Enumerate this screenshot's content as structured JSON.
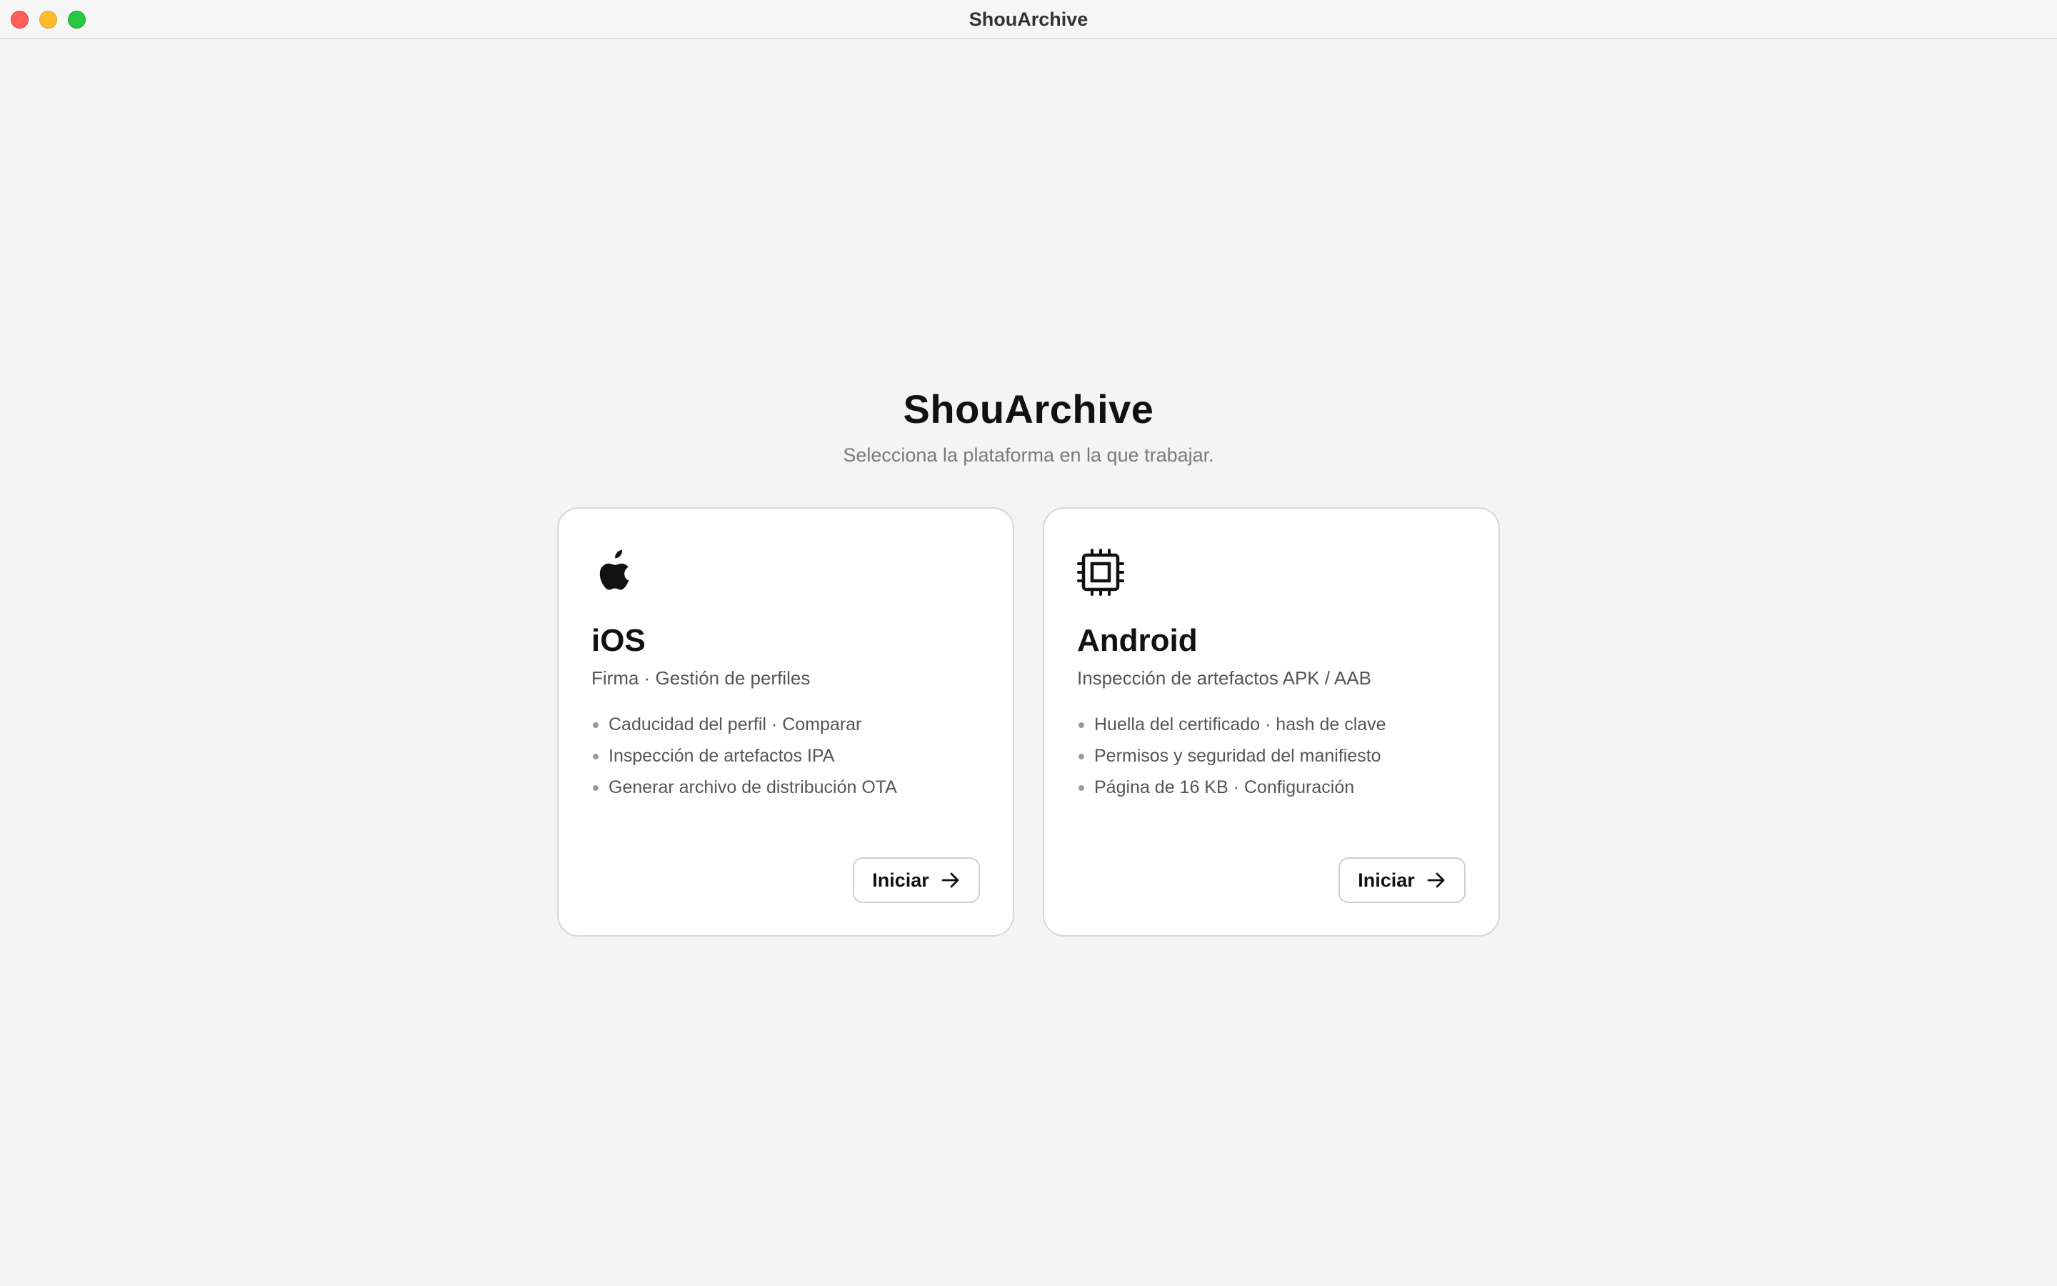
{
  "window": {
    "title": "ShouArchive"
  },
  "header": {
    "title": "ShouArchive",
    "subtitle": "Selecciona la plataforma en la que trabajar."
  },
  "platforms": [
    {
      "icon": "apple-logo-icon",
      "title": "iOS",
      "subtitle": "Firma · Gestión de perfiles",
      "features": [
        "Caducidad del perfil · Comparar",
        "Inspección de artefactos IPA",
        "Generar archivo de distribución OTA"
      ],
      "button_label": "Iniciar"
    },
    {
      "icon": "chip-icon",
      "title": "Android",
      "subtitle": "Inspección de artefactos APK / AAB",
      "features": [
        "Huella del certificado · hash de clave",
        "Permisos y seguridad del manifiesto",
        "Página de 16 KB · Configuración"
      ],
      "button_label": "Iniciar"
    }
  ],
  "colors": {
    "background": "#f4f4f4",
    "card": "#ffffff",
    "close": "#ff5f57",
    "minimize": "#febc2e",
    "zoom": "#28c840"
  }
}
